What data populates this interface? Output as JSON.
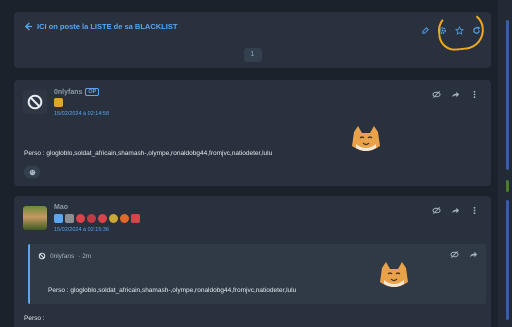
{
  "topic": {
    "title": "ICI on poste la LISTE de sa BLACKLIST",
    "page": "1"
  },
  "posts": [
    {
      "author": "0nlyfans",
      "op_label": "OP",
      "date": "15/02/2024 à 02:14:58",
      "text": "Perso : glogloblo,soldat_africain,shamash-,olympe,ronaldobg44,fromjvc,natiodeter,lulu"
    },
    {
      "author": "Mao",
      "date": "15/02/2024 à 02:15:36",
      "quote": {
        "author": "0nlyfans",
        "time": "· 2m",
        "text": "Perso : glogloblo,soldat_africain,shamash-,olympe,ronaldobg44,fromjvc,natiodeter,lulu"
      },
      "text": "Perso :"
    }
  ],
  "colors": {
    "accent": "#5aa6f2",
    "card": "#28313d",
    "background": "#1b222c",
    "highlight": "#f2a81e"
  },
  "icons": [
    "back-arrow-icon",
    "edit-icon",
    "settings-icon",
    "star-icon",
    "refresh-icon",
    "hide-icon",
    "share-icon",
    "more-icon",
    "banned-icon",
    "smiley-icon"
  ]
}
